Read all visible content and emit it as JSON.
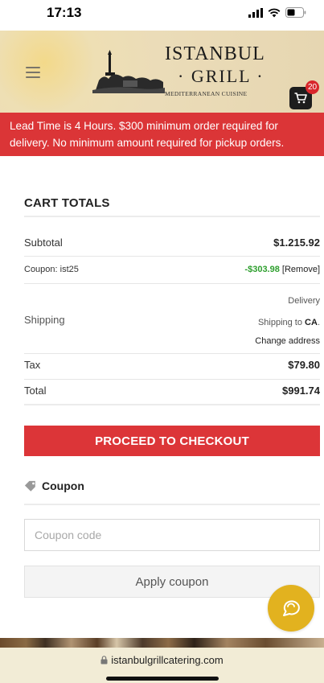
{
  "status_bar": {
    "time": "17:13"
  },
  "header": {
    "logo_title": "ISTANBUL",
    "logo_subtitle": "· GRILL ·",
    "logo_tagline": "MEDITERRANEAN CUISINE",
    "cart_count": "20"
  },
  "banner": {
    "text": "Lead Time is 4 Hours. $300 minimum order required for delivery. No minimum amount required for pickup orders."
  },
  "cart_totals": {
    "title": "CART TOTALS",
    "subtotal_label": "Subtotal",
    "subtotal_value": "$1.215.92",
    "coupon_label": "Coupon: ist25",
    "coupon_discount": "-$303.98",
    "coupon_remove": "[Remove]",
    "shipping_label": "Shipping",
    "shipping_method": "Delivery",
    "shipping_to_prefix": "Shipping to ",
    "shipping_to_region": "CA",
    "shipping_to_suffix": ".",
    "change_address": "Change address",
    "tax_label": "Tax",
    "tax_value": "$79.80",
    "total_label": "Total",
    "total_value": "$991.74"
  },
  "checkout": {
    "label": "PROCEED TO CHECKOUT"
  },
  "coupon": {
    "title": "Coupon",
    "input_placeholder": "Coupon code",
    "input_value": "",
    "apply_label": "Apply coupon"
  },
  "browser": {
    "url": "istanbulgrillcatering.com"
  },
  "colors": {
    "accent_red": "#db3537",
    "chat_yellow": "#e2b21f",
    "discount_green": "#2e9f2e"
  },
  "icons": [
    "menu-icon",
    "cart-icon",
    "tag-icon",
    "chat-icon",
    "lock-icon",
    "signal-icon",
    "wifi-icon",
    "battery-icon"
  ]
}
